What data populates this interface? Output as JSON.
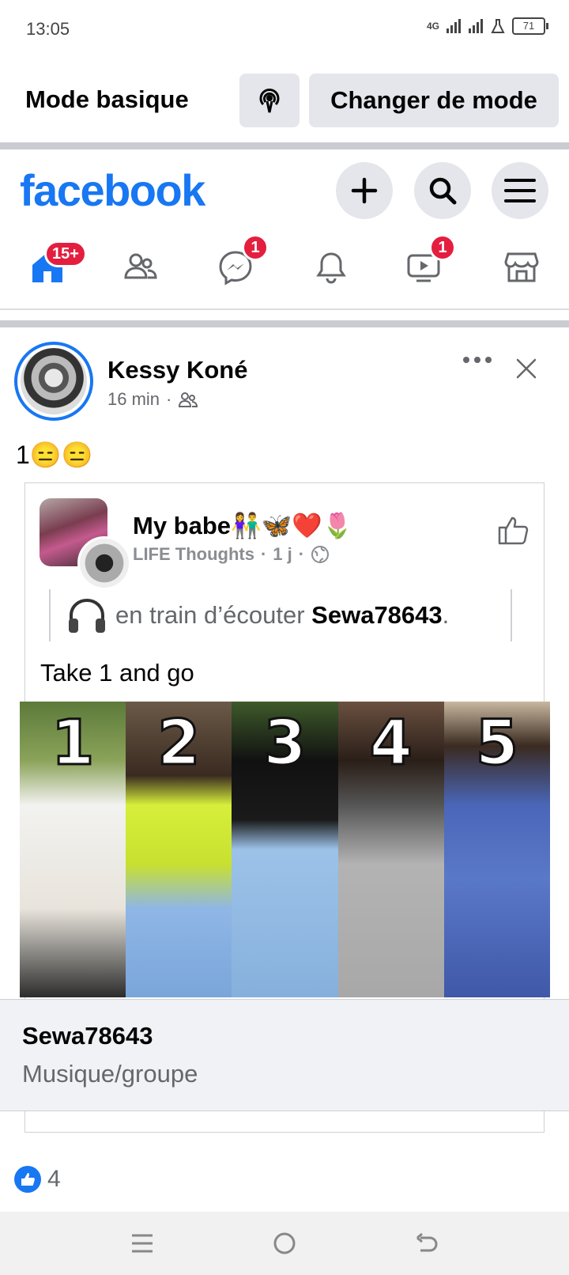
{
  "status_bar": {
    "time": "13:05",
    "network": "4G",
    "battery": "71"
  },
  "mode_bar": {
    "title": "Mode basique",
    "change_label": "Changer de mode"
  },
  "header": {
    "logo": "facebook"
  },
  "nav": {
    "home_badge": "15+",
    "messenger_badge": "1",
    "video_badge": "1"
  },
  "post": {
    "author": "Kessy Koné",
    "time": "16 min",
    "text": "1😑😑",
    "shared": {
      "name": "My babe👫🦋❤️🌷",
      "group": "LIFE Thoughts",
      "time": "1 j",
      "listening_prefix": "en train d’écouter",
      "listening_artist": "Sewa78643",
      "listening_suffix": ".",
      "text": "Take 1 and go",
      "collage_numbers": [
        "1",
        "2",
        "3",
        "4",
        "5"
      ]
    },
    "music_card": {
      "title": "Sewa78643",
      "subtitle": "Musique/groupe"
    },
    "likes_count": "4"
  },
  "colors": {
    "brand": "#1877f2",
    "badge": "#e41e3f"
  }
}
